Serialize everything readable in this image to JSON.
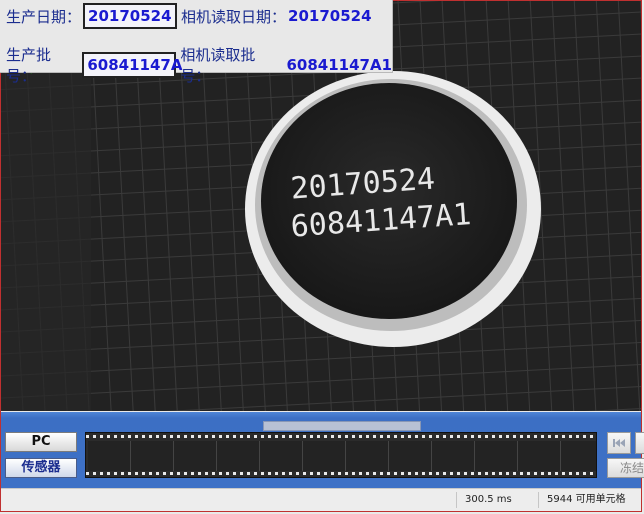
{
  "info": {
    "prod_date_label": "生产日期：",
    "prod_date_value": "20170524",
    "read_date_label": "相机读取日期：",
    "read_date_value": "20170524",
    "prod_batch_label": "生产批号：",
    "prod_batch_value": "60841147A",
    "read_batch_label": "相机读取批号：",
    "read_batch_value": "60841147A1"
  },
  "camera_image": {
    "line1": "20170524",
    "line2": "60841147A1"
  },
  "result": {
    "icon": "check-icon",
    "color": "#22ee22"
  },
  "controls": {
    "pc_label": "PC",
    "sensor_label": "传感器",
    "first_frame_icon": "skip-first-icon",
    "freeze_label": "冻结"
  },
  "status": {
    "time": "300.5 ms",
    "cells": "5944 可用单元格"
  }
}
